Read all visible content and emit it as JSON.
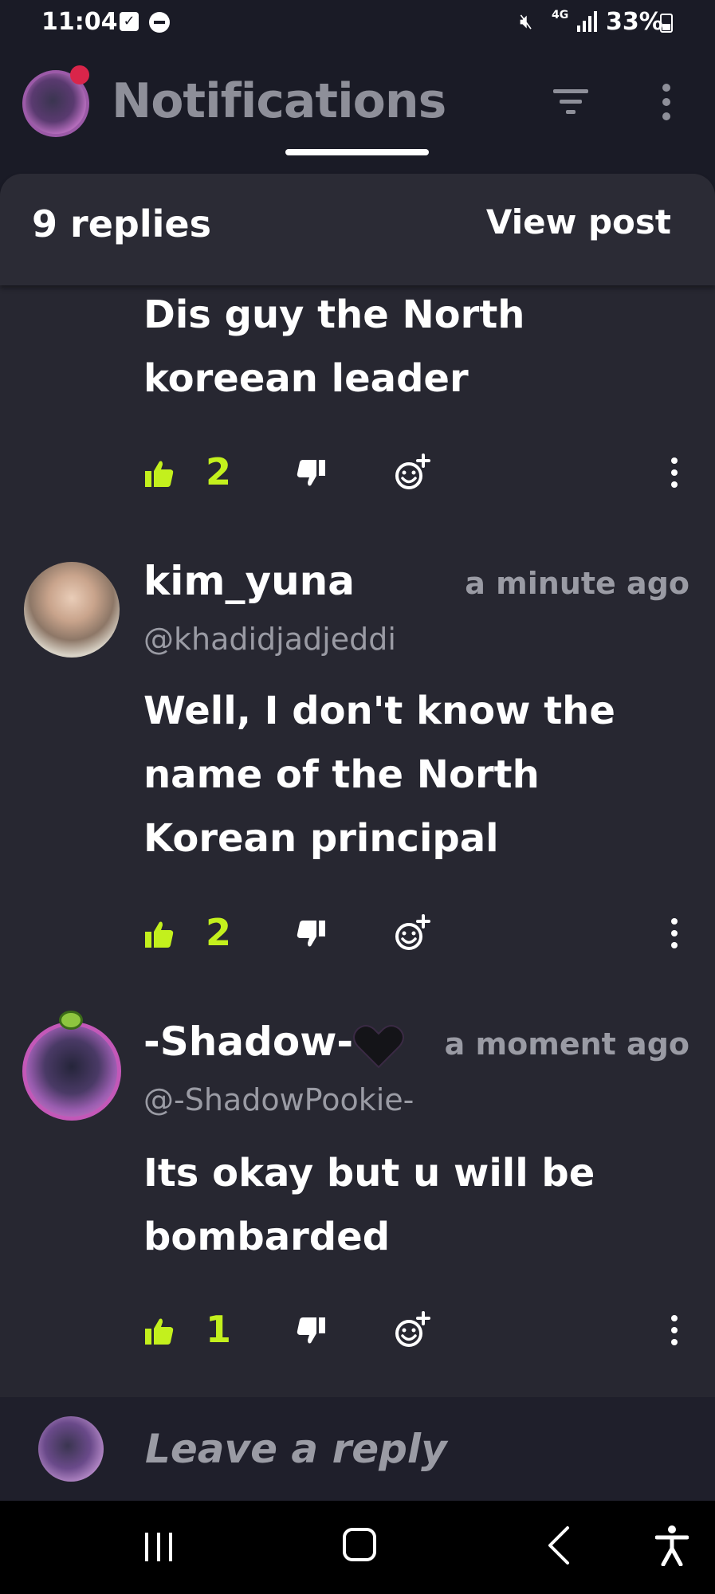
{
  "status_bar": {
    "time": "11:04",
    "network": "4G",
    "battery": "33%"
  },
  "header": {
    "title": "Notifications",
    "icons": [
      "filter-icon",
      "more-vert-icon"
    ]
  },
  "thread": {
    "replies_count": "9 replies",
    "view_post_label": "View post"
  },
  "comments": [
    {
      "text": "Dis guy the North koreean leader",
      "likes": "2"
    },
    {
      "username": "kim_yuna",
      "handle": "@khadidjadjeddi",
      "time": "a minute ago",
      "text": "Well, I don't know the name of the North Korean principal",
      "likes": "2"
    },
    {
      "username": "-Shadow-",
      "handle": "@-ShadowPookie-",
      "time": "a moment ago",
      "text": "Its okay but u will be bombarded",
      "likes": "1"
    }
  ],
  "reply_bar": {
    "placeholder": "Leave a reply"
  },
  "colors": {
    "background": "#1a1b26",
    "sheet": "#272731",
    "accent_like": "#c3f01d",
    "muted_text": "#9a9ba4"
  }
}
